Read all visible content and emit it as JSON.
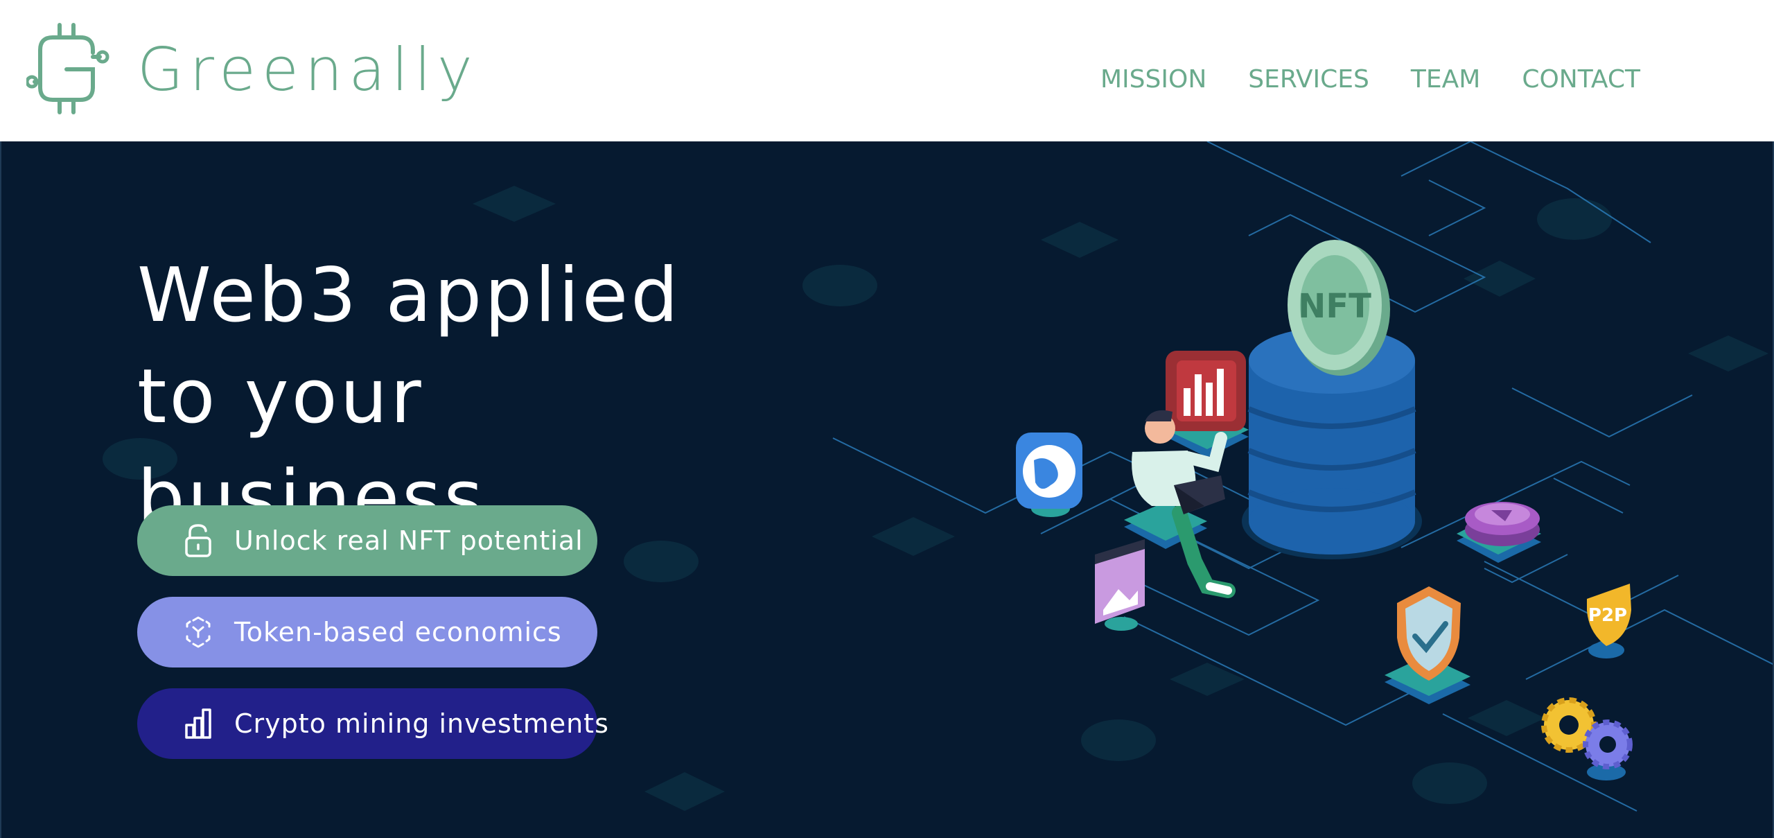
{
  "header": {
    "brand": "Greenally",
    "logo_icon": "greenally-g-circuit-logo",
    "nav": [
      {
        "label": "MISSION"
      },
      {
        "label": "SERVICES"
      },
      {
        "label": "TEAM"
      },
      {
        "label": "CONTACT"
      }
    ]
  },
  "hero": {
    "headline_line1": "Web3 applied",
    "headline_line2": "to your business",
    "ctas": [
      {
        "label": "Unlock real NFT potential",
        "icon": "unlock-icon",
        "color": "#6aaa8c"
      },
      {
        "label": "Token-based economics",
        "icon": "token-cube-icon",
        "color": "#8691e6"
      },
      {
        "label": "Crypto mining investments",
        "icon": "bar-chart-icon",
        "color": "#22208a"
      }
    ],
    "illustration": {
      "coin_text": "NFT",
      "badge_text": "P2P"
    }
  },
  "colors": {
    "brand_green": "#6aaa8c",
    "hero_bg": "#061a30",
    "lavender": "#8691e6",
    "indigo": "#22208a"
  }
}
